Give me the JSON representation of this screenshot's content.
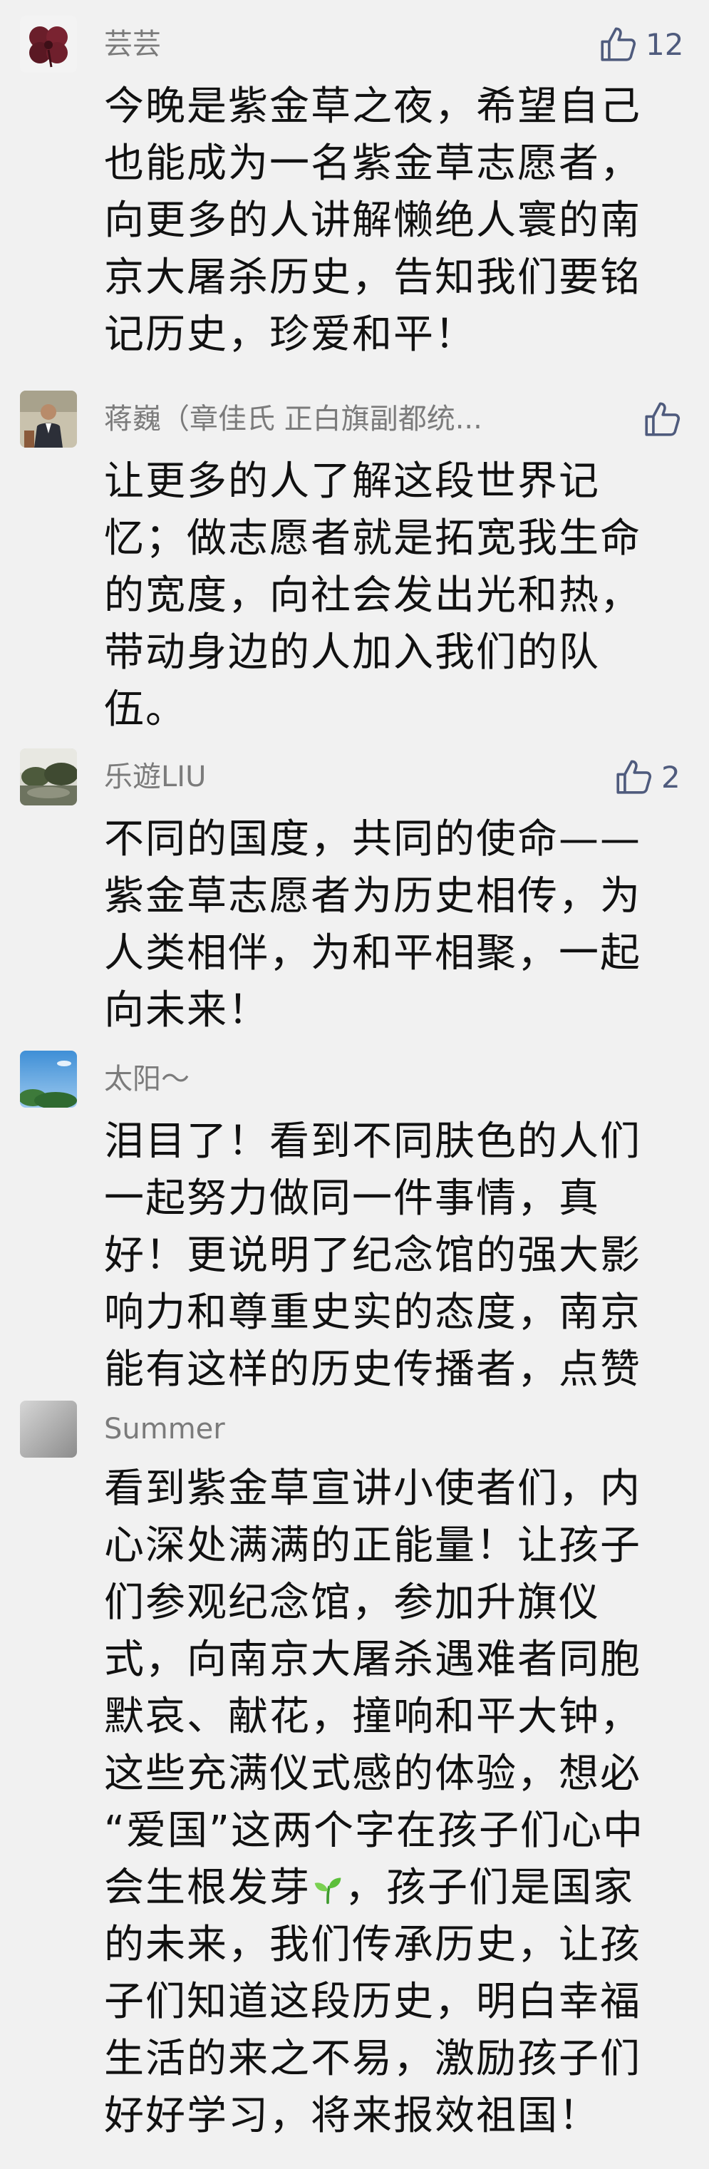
{
  "comments": [
    {
      "author": "芸芸",
      "likes": "12",
      "lines": [
        "今晚是紫金草之夜，希望自己",
        "也能成为一名紫金草志愿者，",
        "向更多的人讲解懒绝人寰的南",
        "京大屠杀历史，告知我们要铭",
        "记历史，珍爱和平！"
      ]
    },
    {
      "author": "蒋巍（章佳氏 正白旗副都统...",
      "likes": "",
      "lines": [
        "让更多的人了解这段世界记",
        "忆；做志愿者就是拓宽我生命",
        "的宽度，向社会发出光和热，",
        "带动身边的人加入我们的队",
        "伍。"
      ]
    },
    {
      "author": "乐遊LIU",
      "likes": "2",
      "lines": [
        "不同的国度，共同的使命——",
        "紫金草志愿者为历史相传，为",
        "人类相伴，为和平相聚，一起",
        "向未来！"
      ]
    },
    {
      "author": "太阳～",
      "likes": "",
      "lines": [
        "泪目了！看到不同肤色的人们",
        "一起努力做同一件事情，真",
        "好！更说明了纪念馆的强大影",
        "响力和尊重史实的态度，南京",
        "能有这样的历史传播者，点赞"
      ]
    },
    {
      "author": "Summer",
      "likes": "",
      "lines": [
        "看到紫金草宣讲小使者们，内",
        "心深处满满的正能量！让孩子",
        "们参观纪念馆，参加升旗仪",
        "式，向南京大屠杀遇难者同胞",
        "默哀、献花，撞响和平大钟，",
        "这些充满仪式感的体验，想必",
        "“爱国”这两个字在孩子们心中",
        "会生根发芽",
        "的未来，我们传承历史，让孩",
        "子们知道这段历史，明白幸福",
        "生活的来之不易，激励孩子们",
        "好好学习，将来报效祖国！"
      ],
      "line8_tail": "，孩子们是国家"
    }
  ],
  "colors": {
    "background": "#f1f1f1",
    "name": "#7b7b7b",
    "text": "#111111",
    "like": "#4f5b7d"
  },
  "icons": {
    "like": "thumbs-up-icon",
    "sprout": "sprout-emoji-icon"
  }
}
